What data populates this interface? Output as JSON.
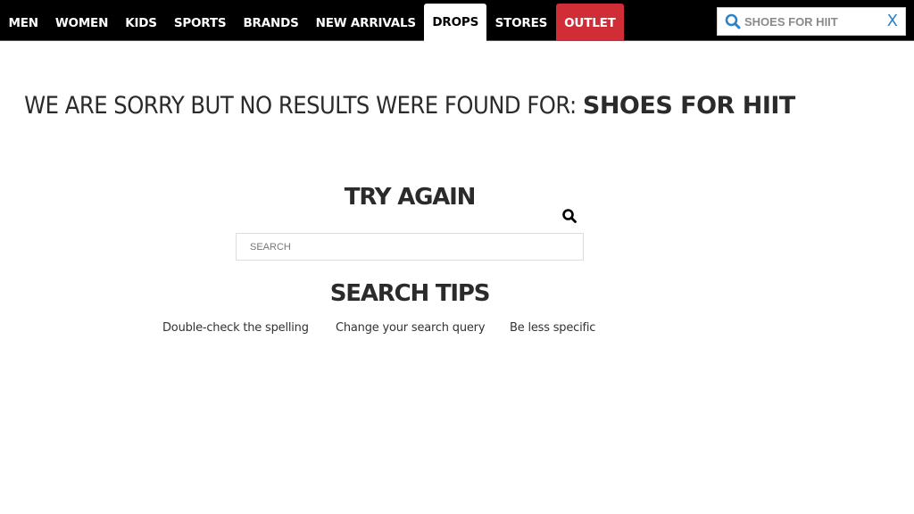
{
  "colors": {
    "topbar_bg": "#000000",
    "outlet_bg": "#d12d36",
    "search_icon_blue": "#2d82c6",
    "text_dark": "#2b2b2b"
  },
  "nav": {
    "items": [
      {
        "label": "MEN",
        "state": "normal"
      },
      {
        "label": "WOMEN",
        "state": "normal"
      },
      {
        "label": "KIDS",
        "state": "normal"
      },
      {
        "label": "SPORTS",
        "state": "normal"
      },
      {
        "label": "BRANDS",
        "state": "normal"
      },
      {
        "label": "NEW ARRIVALS",
        "state": "normal"
      },
      {
        "label": "DROPS",
        "state": "active"
      },
      {
        "label": "STORES",
        "state": "normal"
      },
      {
        "label": "OUTLET",
        "state": "highlight"
      }
    ]
  },
  "top_search": {
    "value": "SHOES FOR HIIT",
    "icon": "search-icon",
    "clear_label": "X"
  },
  "results": {
    "sorry_prefix": "WE ARE SORRY BUT NO RESULTS WERE FOUND FOR: ",
    "search_term": "SHOES FOR HIIT"
  },
  "try_again": {
    "title": "TRY AGAIN",
    "placeholder": "SEARCH",
    "icon": "search-icon"
  },
  "tips": {
    "title": "SEARCH TIPS",
    "items": [
      "Double-check the spelling",
      "Change your search query",
      "Be less specific"
    ]
  }
}
